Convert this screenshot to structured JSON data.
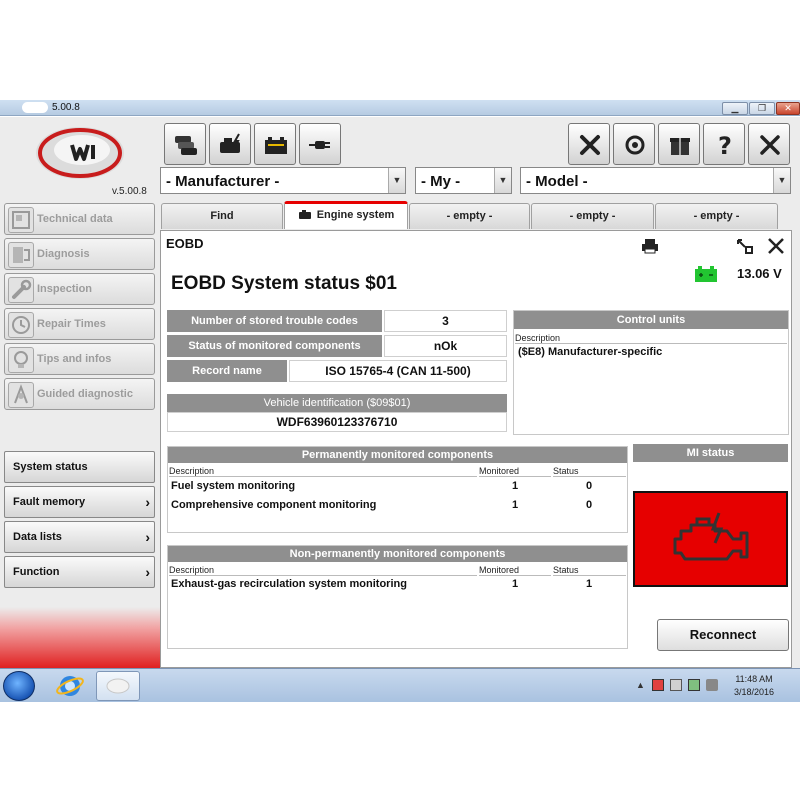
{
  "window": {
    "title_version": "5.00.8",
    "min": "▁",
    "max": "❐",
    "close": "✕"
  },
  "app": {
    "version": "v.5.00.8"
  },
  "nav": {
    "items": [
      {
        "label": "Technical data"
      },
      {
        "label": "Diagnosis"
      },
      {
        "label": "Inspection"
      },
      {
        "label": "Repair Times"
      },
      {
        "label": "Tips and infos"
      },
      {
        "label": "Guided diagnostic"
      }
    ]
  },
  "functions": [
    {
      "label": "System status",
      "arrow": ""
    },
    {
      "label": "Fault memory",
      "arrow": "›"
    },
    {
      "label": "Data lists",
      "arrow": "›"
    },
    {
      "label": "Function",
      "arrow": "›"
    }
  ],
  "selectors": {
    "manufacturer": "- Manufacturer -",
    "my": "- My -",
    "model": "- Model -",
    "dropdown": "▼"
  },
  "tabs": [
    "Find",
    "Engine system",
    "- empty -",
    "-  empty  -",
    "-  empty  -"
  ],
  "content": {
    "section": "EOBD",
    "heading": "EOBD System status  $01",
    "voltage": "13.06 V",
    "stats": {
      "stored_codes_label": "Number of stored trouble codes",
      "stored_codes_value": "3",
      "monitored_label": "Status of monitored components",
      "monitored_value": "nOk",
      "record_label": "Record name",
      "record_value": "ISO 15765-4 (CAN 11-500)"
    },
    "vehicle_id": {
      "label": "Vehicle identification    ($09$01)",
      "value": "WDF63960123376710"
    },
    "control_units": {
      "title": "Control units",
      "col_description": "Description",
      "rows": [
        "($E8) Manufacturer-specific"
      ]
    },
    "permanent": {
      "title": "Permanently monitored components",
      "columns": {
        "description": "Description",
        "monitored": "Monitored",
        "status": "Status"
      },
      "rows": [
        {
          "description": "Fuel system monitoring",
          "monitored": "1",
          "status": "0"
        },
        {
          "description": "Comprehensive component monitoring",
          "monitored": "1",
          "status": "0"
        }
      ]
    },
    "non_permanent": {
      "title": "Non-permanently monitored components",
      "columns": {
        "description": "Description",
        "monitored": "Monitored",
        "status": "Status"
      },
      "rows": [
        {
          "description": "Exhaust-gas recirculation system monitoring",
          "monitored": "1",
          "status": "1"
        }
      ]
    },
    "mi_status": {
      "title": "MI status",
      "icon": "engine-warning-icon",
      "color": "#e60000"
    },
    "reconnect": "Reconnect"
  },
  "taskbar": {
    "time": "11:48 AM",
    "date": "3/18/2016"
  },
  "colors": {
    "accent": "#e60000",
    "header_gray": "#8f8f8f",
    "battery_green": "#22c531"
  }
}
